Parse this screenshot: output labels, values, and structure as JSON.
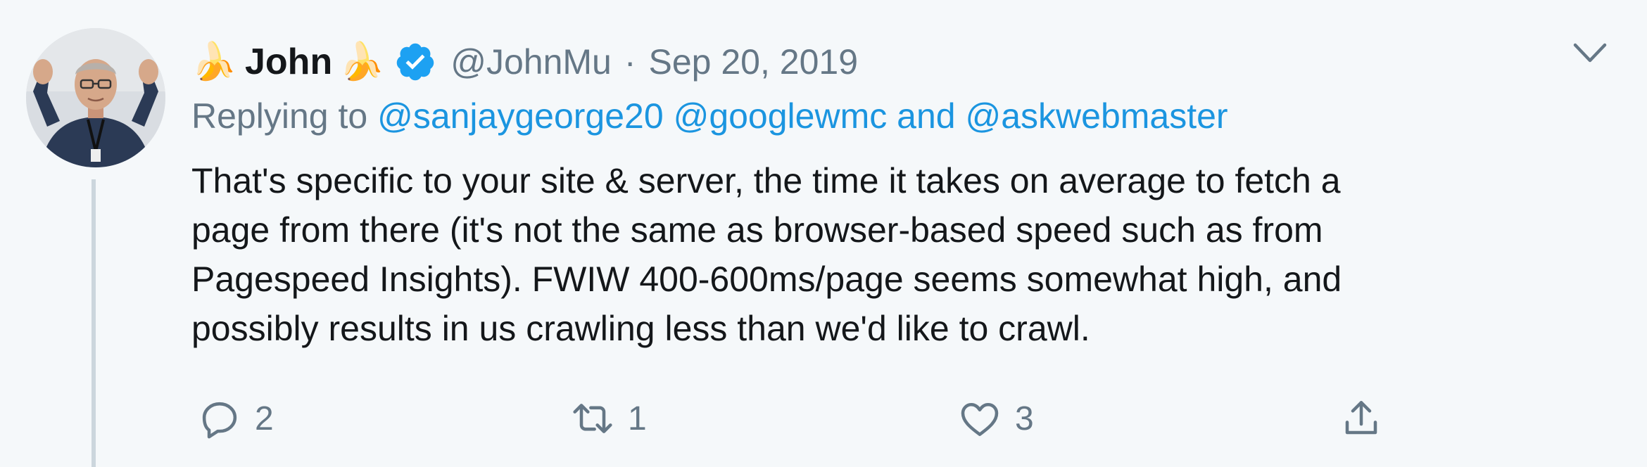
{
  "tweet": {
    "author": {
      "emoji_left": "🍌",
      "name": "John",
      "emoji_right": "🍌",
      "handle": "@JohnMu",
      "verified": true
    },
    "separator": "·",
    "date": "Sep 20, 2019",
    "replying": {
      "prefix": "Replying to",
      "mention_1": "@sanjaygeorge20",
      "mention_2": "@googlewmc",
      "joiner": "and",
      "mention_3": "@askwebmaster"
    },
    "text_lines": [
      "That's specific to your site & server, the time it takes on average to fetch a",
      "page from there (it's not the same as browser-based speed such as from",
      "Pagespeed Insights). FWIW 400-600ms/page seems somewhat high, and",
      "possibly results in us crawling less than we'd like to crawl."
    ],
    "actions": {
      "reply_count": "2",
      "retweet_count": "1",
      "like_count": "3"
    },
    "icons": {
      "reply": "reply-icon",
      "retweet": "retweet-icon",
      "like": "heart-icon",
      "share": "share-icon",
      "caret": "chevron-down-icon",
      "verified": "verified-badge-icon"
    },
    "colors": {
      "background": "#f5f8fa",
      "text": "#14171a",
      "muted": "#657786",
      "link": "#1b95e0",
      "verified": "#1da1f2"
    }
  }
}
